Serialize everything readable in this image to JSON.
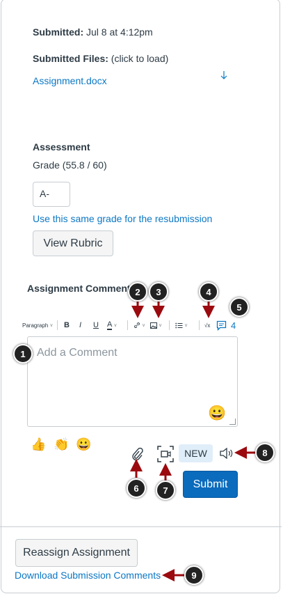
{
  "submission": {
    "submitted_label": "Submitted:",
    "submitted_value": "Jul 8 at 4:12pm",
    "files_label": "Submitted Files:",
    "files_hint": "(click to load)",
    "file_name": "Assignment.docx"
  },
  "assessment": {
    "heading": "Assessment",
    "grade_label": "Grade (55.8 / 60)",
    "grade_value": "A-",
    "same_grade_link": "Use this same grade for the resubmission",
    "view_rubric": "View Rubric"
  },
  "comments": {
    "heading": "Assignment Comments",
    "toolbar": {
      "paragraph": "Paragraph",
      "bold": "B",
      "italic": "I",
      "underline": "U",
      "text_color": "A",
      "count": "4"
    },
    "placeholder": "Add a Comment",
    "quick_emojis": [
      "👍",
      "👏",
      "😀"
    ],
    "emoji_picker": "😀",
    "new_badge": "NEW",
    "submit": "Submit"
  },
  "actions": {
    "reassign": "Reassign Assignment",
    "download": "Download Submission Comments"
  },
  "callouts": [
    "1",
    "2",
    "3",
    "4",
    "5",
    "6",
    "7",
    "8",
    "9"
  ],
  "colors": {
    "link": "#0b77c4",
    "submit": "#0b6bbd",
    "arrow": "#9b0a0f",
    "callout": "#222222"
  }
}
